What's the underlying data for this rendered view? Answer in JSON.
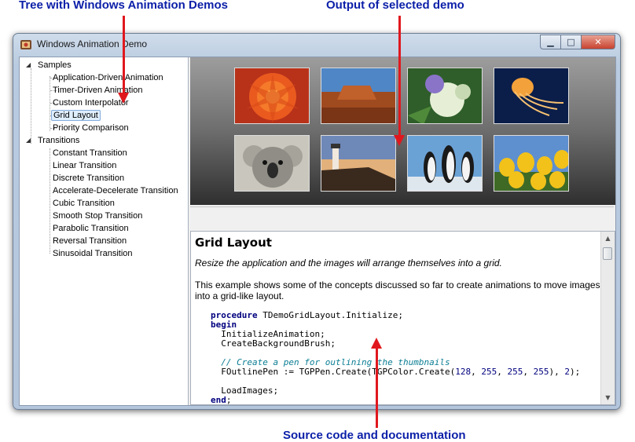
{
  "callouts": {
    "tree": "Tree with Windows Animation Demos",
    "output": "Output of selected demo",
    "source": "Source code and documentation"
  },
  "window": {
    "title": "Windows Animation Demo",
    "minimize_glyph": "▁",
    "maximize_glyph": "□",
    "close_glyph": "✕"
  },
  "tree": {
    "groups": [
      {
        "label": "Samples",
        "items": [
          "Application-Driven Animation",
          "Timer-Driven Animation",
          "Custom Interpolator",
          "Grid Layout",
          "Priority Comparison"
        ]
      },
      {
        "label": "Transitions",
        "items": [
          "Constant Transition",
          "Linear Transition",
          "Discrete Transition",
          "Accelerate-Decelerate Transition",
          "Cubic Transition",
          "Smooth Stop Transition",
          "Parabolic Transition",
          "Reversal Transition",
          "Sinusoidal Transition"
        ]
      }
    ],
    "selected": "Grid Layout",
    "expander_glyph": "◢"
  },
  "output": {
    "thumbnails": [
      "orange-flower",
      "desert-butte",
      "white-hydrangea",
      "jellyfish",
      "koala",
      "lighthouse",
      "penguins",
      "tulips"
    ]
  },
  "doc": {
    "title": "Grid Layout",
    "intro": "Resize the application and the images will arrange themselves into a grid.",
    "body": "This example shows some of the concepts discussed so far to create animations to move images into a grid-like layout.",
    "code": {
      "l1_kw": "procedure",
      "l1_rest": " TDemoGridLayout.Initialize;",
      "l2_kw": "begin",
      "l3": "  InitializeAnimation;",
      "l4": "  CreateBackgroundBrush;",
      "l6_comment": "  // Create a pen for outlining the thumbnails",
      "l7_a": "  FOutlinePen := TGPPen.Create(TGPColor.Create(",
      "l7_n1": "128",
      "l7_n2": "255",
      "l7_n3": "255",
      "l7_n4": "255",
      "l7_n5": "2",
      "l9": "  LoadImages;",
      "l10_kw": "end",
      "l10_rest": ";"
    }
  },
  "scrollbar": {
    "up_glyph": "▲",
    "down_glyph": "▼"
  },
  "colors": {
    "callout_text": "#0b1fa8",
    "arrow": "#e0181e",
    "selection": "#dfeefc"
  }
}
